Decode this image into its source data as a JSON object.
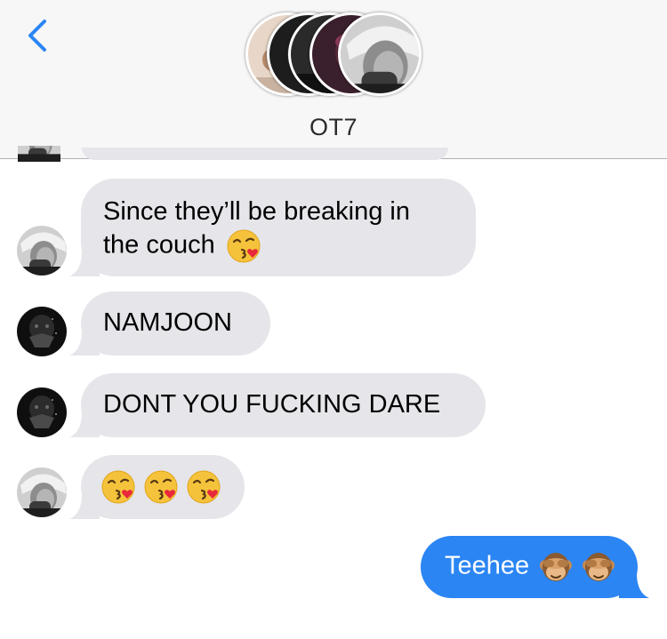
{
  "header": {
    "title": "OT7",
    "back_icon": "chevron-left-icon",
    "accent": "#2b85f3"
  },
  "messages": [
    {
      "from": "member-rm",
      "text": "Since they’ll be breaking in",
      "text2": "the couch",
      "emoji": [
        "kissing-heart-emoji"
      ]
    },
    {
      "from": "member-dark",
      "text": "NAMJOON"
    },
    {
      "from": "member-dark",
      "text": "DONT YOU FUCKING DARE"
    },
    {
      "from": "member-rm",
      "text": "",
      "emoji": [
        "kissing-heart-emoji",
        "kissing-heart-emoji",
        "kissing-heart-emoji"
      ]
    },
    {
      "from": "me",
      "text": "Teehee",
      "emoji": [
        "see-no-evil-monkey-emoji",
        "see-no-evil-monkey-emoji"
      ]
    }
  ],
  "colors": {
    "received_bubble": "#e5e5ea",
    "sent_bubble": "#2b85f3"
  }
}
